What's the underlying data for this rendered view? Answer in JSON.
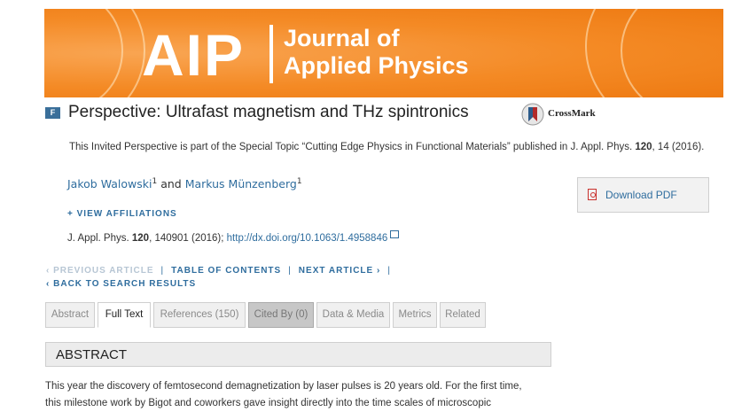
{
  "banner": {
    "logo_aip": "AIP",
    "journal_line1": "Journal of",
    "journal_line2": "Applied Physics"
  },
  "article": {
    "badge": "F",
    "title": "Perspective: Ultrafast magnetism and THz spintronics",
    "crossmark_label": "CrossMark",
    "note_prefix": "This Invited Perspective is part of the Special Topic “Cutting Edge Physics in Functional Materials” published in J. Appl. Phys. ",
    "note_volume": "120",
    "note_suffix": ", 14 (2016).",
    "authors": [
      {
        "name": "Jakob Walowski",
        "sup": "1"
      },
      {
        "name": "Markus Münzenberg",
        "sup": "1"
      }
    ],
    "author_joiner": " and ",
    "view_affiliations": "+ VIEW AFFILIATIONS",
    "citation_prefix": "J. Appl. Phys. ",
    "citation_volume": "120",
    "citation_suffix": ", 140901 (2016); ",
    "doi": "http://dx.doi.org/10.1063/1.4958846"
  },
  "download": {
    "label": "Download PDF",
    "icon": "pdf-icon"
  },
  "nav": {
    "previous": "PREVIOUS ARTICLE",
    "toc": "TABLE OF CONTENTS",
    "next": "NEXT ARTICLE",
    "back": "BACK TO SEARCH RESULTS",
    "chevron_left": "‹",
    "chevron_right": "›",
    "separator": "|"
  },
  "tabs": [
    {
      "label": "Abstract",
      "state": "inactive"
    },
    {
      "label": "Full Text",
      "state": "active"
    },
    {
      "label": "References (150)",
      "state": "inactive"
    },
    {
      "label": "Cited By (0)",
      "state": "cited"
    },
    {
      "label": "Data & Media",
      "state": "inactive"
    },
    {
      "label": "Metrics",
      "state": "inactive"
    },
    {
      "label": "Related",
      "state": "inactive"
    }
  ],
  "abstract": {
    "heading": "ABSTRACT",
    "line1": "This year the discovery of femtosecond demagnetization by laser pulses is 20 years old. For the first time,",
    "line2": "this milestone work by Bigot and coworkers gave insight directly into the time scales of microscopic"
  },
  "colors": {
    "banner_orange": "#f48a25",
    "link_blue": "#2f6d9e",
    "badge_blue": "#3a6f9a"
  }
}
